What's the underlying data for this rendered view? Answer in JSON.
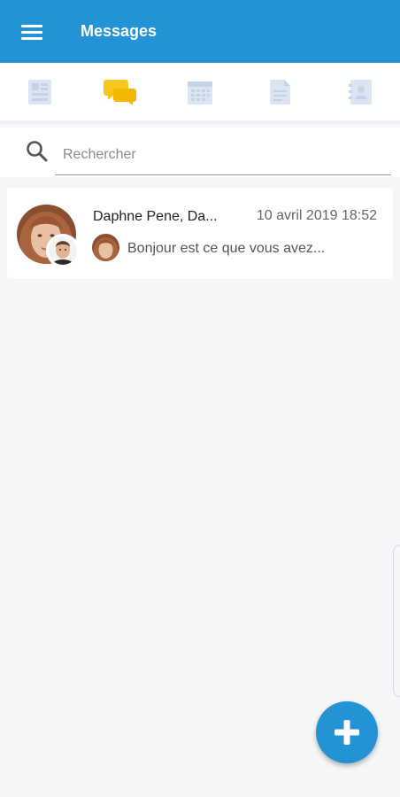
{
  "app": {
    "title": "Messages"
  },
  "icons": {
    "menu": "menu-icon",
    "tabs": [
      "news-icon",
      "chat-bubbles-icon",
      "calendar-icon",
      "document-icon",
      "contacts-icon"
    ],
    "search": "search-icon",
    "fab": "plus-icon"
  },
  "colors": {
    "primary": "#2493d6",
    "active_tab": "#f6c81e",
    "inactive_tab": "#dce6f2"
  },
  "search": {
    "placeholder": "Rechercher"
  },
  "conversations": [
    {
      "name": "Daphne Pene, Da...",
      "date": "10 avril 2019 18:52",
      "preview": "Bonjour est ce que vous avez..."
    }
  ]
}
